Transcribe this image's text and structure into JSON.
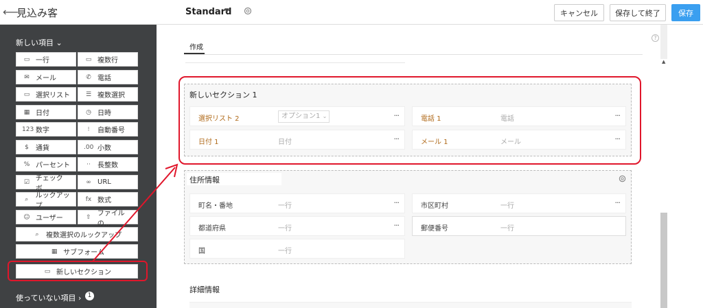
{
  "header": {
    "back_icon": "arrow-left-icon",
    "title": "見込み客",
    "layout_name": "Standard",
    "cancel_label": "キャンセル",
    "save_close_label": "保存して終了",
    "save_label": "保存"
  },
  "sidebar": {
    "new_items_label": "新しい項目",
    "items": [
      {
        "label": "一行",
        "icon": "▭"
      },
      {
        "label": "複数行",
        "icon": "▭"
      },
      {
        "label": "メール",
        "icon": "✉"
      },
      {
        "label": "電話",
        "icon": "✆"
      },
      {
        "label": "選択リスト",
        "icon": "▭"
      },
      {
        "label": "複数選択",
        "icon": "☰"
      },
      {
        "label": "日付",
        "icon": "▦"
      },
      {
        "label": "日時",
        "icon": "◷"
      },
      {
        "label": "数字",
        "icon": "123"
      },
      {
        "label": "自動番号",
        "icon": "⁝"
      },
      {
        "label": "通貨",
        "icon": "$"
      },
      {
        "label": "小数",
        "icon": ".00"
      },
      {
        "label": "パーセント",
        "icon": "%"
      },
      {
        "label": "長整数",
        "icon": "··"
      },
      {
        "label": "チェックボ...",
        "icon": "☑"
      },
      {
        "label": "URL",
        "icon": "∞"
      },
      {
        "label": "ルックアップ",
        "icon": "⌕"
      },
      {
        "label": "数式",
        "icon": "fx"
      },
      {
        "label": "ユーザー",
        "icon": "☺"
      },
      {
        "label": "ファイルの...",
        "icon": "⇧"
      }
    ],
    "multi_lookup_label": "複数選択のルックアップ",
    "subform_label": "サブフォーム",
    "new_section_label": "新しいセクション",
    "unused_label": "使っていない項目",
    "unused_count": "1"
  },
  "main": {
    "tab_label": "作成",
    "help_label": "?",
    "new_section": {
      "title": "新しいセクション 1",
      "fields": [
        {
          "label": "選択リスト 2",
          "value": "オプション1"
        },
        {
          "label": "電話 1",
          "value": "電話"
        },
        {
          "label": "日付 1",
          "value": "日付"
        },
        {
          "label": "メール 1",
          "value": "メール"
        }
      ]
    },
    "address_section": {
      "title": "住所情報",
      "fields": [
        {
          "label": "町名・番地",
          "value": "一行"
        },
        {
          "label": "市区町村",
          "value": "一行"
        },
        {
          "label": "都道府県",
          "value": "一行"
        },
        {
          "label": "郵便番号",
          "value": "一行"
        },
        {
          "label": "国",
          "value": "一行"
        }
      ]
    },
    "detail_section": {
      "title": "詳細情報"
    },
    "more_label": "···"
  },
  "colors": {
    "accent": "#3a9ff0",
    "sidebar_bg": "#3f4143",
    "highlight": "#e0162b",
    "field_label": "#b06a1a"
  }
}
